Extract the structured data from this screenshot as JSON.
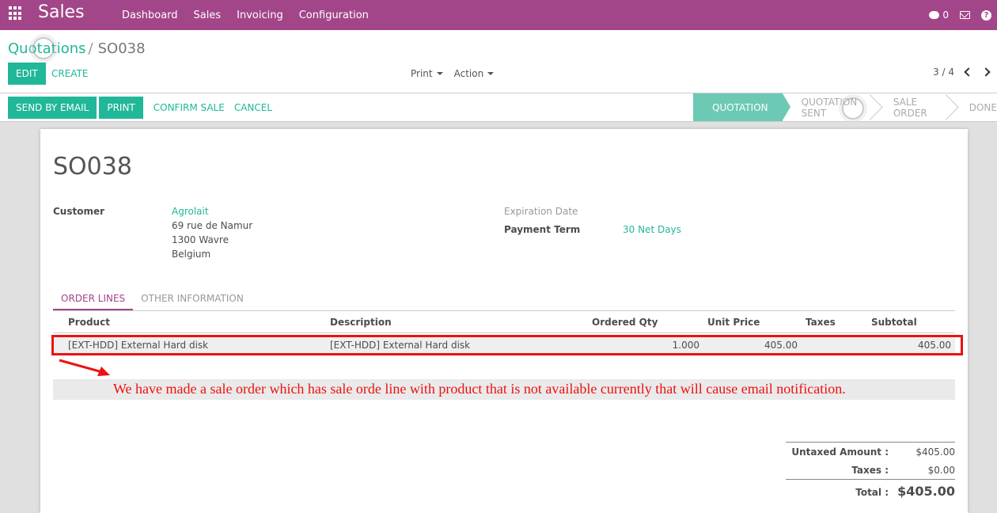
{
  "topbar": {
    "brand": "Sales",
    "menu": [
      "Dashboard",
      "Sales",
      "Invoicing",
      "Configuration"
    ],
    "chat_count": "0",
    "icons": [
      "apps-icon",
      "chat-icon",
      "mail-icon",
      "help-icon"
    ]
  },
  "control": {
    "breadcrumb_parent": "Quotations",
    "breadcrumb_sep": "/",
    "breadcrumb_current": "SO038",
    "edit_label": "EDIT",
    "create_label": "CREATE",
    "print_label": "Print",
    "action_label": "Action",
    "pager": "3 / 4"
  },
  "statusbar": {
    "send_email": "SEND BY EMAIL",
    "print": "PRINT",
    "confirm": "CONFIRM SALE",
    "cancel": "CANCEL",
    "stages": [
      "QUOTATION",
      "QUOTATION SENT",
      "SALE ORDER",
      "DONE"
    ],
    "active_stage": "QUOTATION"
  },
  "form": {
    "title": "SO038",
    "customer_label": "Customer",
    "customer_name": "Agrolait",
    "address": [
      "69 rue de Namur",
      "1300 Wavre",
      "Belgium"
    ],
    "expiration_label": "Expiration Date",
    "payment_term_label": "Payment Term",
    "payment_term": "30 Net Days",
    "tabs": [
      "ORDER LINES",
      "OTHER INFORMATION"
    ],
    "columns": {
      "product": "Product",
      "description": "Description",
      "qty": "Ordered Qty",
      "unit_price": "Unit Price",
      "taxes": "Taxes",
      "subtotal": "Subtotal"
    },
    "line": {
      "product": "[EXT-HDD] External Hard disk",
      "description": "[EXT-HDD] External Hard disk",
      "qty": "1.000",
      "unit_price": "405.00",
      "taxes": "",
      "subtotal": "405.00"
    },
    "annotation": "We have made a sale order which has sale orde line with product that is not available currently that will cause email notification.",
    "totals": {
      "untaxed_label": "Untaxed Amount :",
      "untaxed": "$405.00",
      "taxes_label": "Taxes :",
      "taxes": "$0.00",
      "total_label": "Total :",
      "total": "$405.00"
    }
  },
  "colors": {
    "brand": "#a24689",
    "accent": "#21b799",
    "annotation": "#ee1111"
  }
}
